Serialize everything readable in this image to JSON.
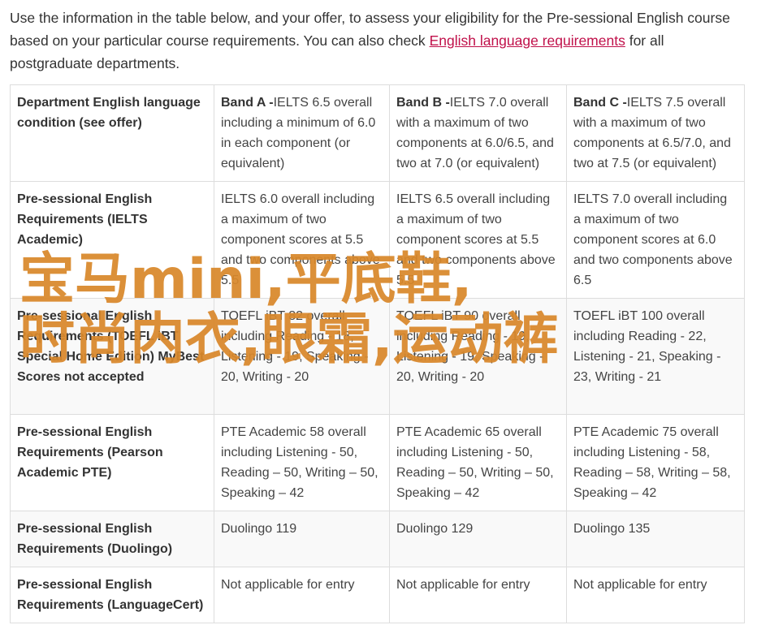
{
  "intro": {
    "text_before": "Use the information in the table below, and your offer, to assess your eligibility for the Pre-sessional English course based on your particular course requirements. You can also check ",
    "link": "English language requirements",
    "text_after": " for all postgraduate departments."
  },
  "table": {
    "header": {
      "row_label": "Department English language condition (see offer)",
      "bands": [
        {
          "label": "Band A -",
          "text": "IELTS 6.5 overall including a minimum of 6.0 in each component (or equivalent)"
        },
        {
          "label": "Band B -",
          "text": "IELTS 7.0 overall with a maximum of two components at 6.0/6.5, and two at 7.0 (or equivalent)"
        },
        {
          "label": "Band C -",
          "text": "IELTS 7.5 overall with a maximum of two components at 6.5/7.0, and two at 7.5 (or equivalent)"
        }
      ]
    },
    "rows": [
      {
        "label": "Pre-sessional English Requirements (IELTS Academic)",
        "cells": [
          "IELTS 6.0 overall including a maximum of two component scores at 5.5 and two components above 5.5",
          "IELTS 6.5 overall including a maximum of two component scores at 5.5 and two components above 5.5",
          "IELTS 7.0 overall including a maximum of two component scores at 6.0 and two components above 6.5"
        ]
      },
      {
        "label": "Pre-sessional English Requirements (TOEFL iBT Special Home Edition) MyBest Scores not accepted",
        "cells": [
          "TOEFL iBT 82 overall including Reading - 18, Listening - 19, Speaking - 20, Writing - 20",
          "TOEFL iBT 90 overall including Reading - 19, Listening - 19, Speaking - 20, Writing - 20",
          "TOEFL iBT 100 overall including Reading - 22, Listening - 21, Speaking - 23, Writing - 21"
        ]
      },
      {
        "label": "Pre-sessional English Requirements (Pearson Academic PTE)",
        "cells": [
          "PTE Academic 58 overall including Listening - 50, Reading – 50, Writing – 50, Speaking – 42",
          "PTE Academic 65 overall including Listening - 50, Reading – 50, Writing – 50, Speaking – 42",
          "PTE Academic 75 overall including Listening - 58, Reading – 58, Writing – 58, Speaking – 42"
        ]
      },
      {
        "label": "Pre-sessional English Requirements (Duolingo)",
        "cells": [
          "Duolingo 119",
          "Duolingo 129",
          "Duolingo 135"
        ]
      },
      {
        "label": "Pre-sessional English Requirements (LanguageCert)",
        "cells": [
          "Not applicable for entry",
          "Not applicable for entry",
          "Not applicable for entry"
        ]
      }
    ]
  },
  "watermark": {
    "line1": "宝马mini,平底鞋,",
    "line2": "时尚内衣,眼霜,运动裤"
  }
}
